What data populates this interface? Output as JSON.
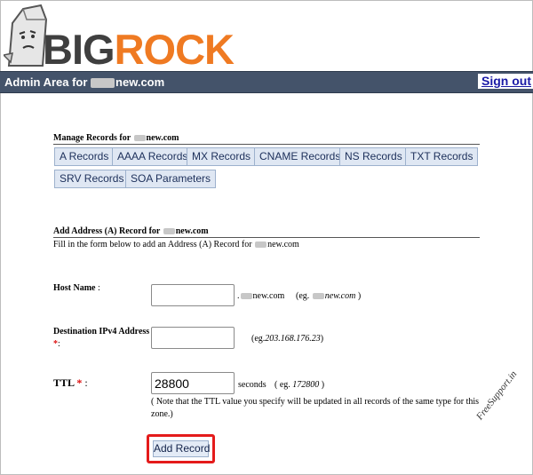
{
  "logo": {
    "big": "BIG",
    "rock": "ROCK"
  },
  "admin_bar": {
    "title_prefix": "Admin Area for ",
    "title_domain": "new.com",
    "sign_out": "Sign out"
  },
  "manage": {
    "heading_prefix": "Manage Records for ",
    "heading_domain": "new.com",
    "buttons": [
      "A Records",
      "AAAA Records",
      "MX Records",
      "CNAME Records",
      "NS Records",
      "TXT Records",
      "SRV Records",
      "SOA Parameters"
    ]
  },
  "add_record": {
    "heading_prefix": "Add Address (A) Record for ",
    "heading_domain": "new.com",
    "description_prefix": "Fill in the form below to add an Address (A) Record for ",
    "description_domain": "new.com"
  },
  "form": {
    "host_name": {
      "label": "Host Name",
      "colon": " :",
      "value": "",
      "suffix_domain": "new.com",
      "example_prefix": "(eg. ",
      "example_domain": "new.com",
      "example_close": ")"
    },
    "destination": {
      "label": "Destination IPv4 Address",
      "required_mark": "*",
      "colon": ":",
      "value": "",
      "example_prefix": "(eg.",
      "example_ip": "203.168.176.23",
      "example_close": ")"
    },
    "ttl": {
      "label": "TTL",
      "required_mark": "*",
      "colon": " :",
      "value": "28800",
      "unit": "seconds",
      "example_prefix": "( eg. ",
      "example_value": "172800",
      "example_close": " )",
      "note": "( Note that the TTL value you specify will be updated in all records of the same type for this zone.)"
    },
    "submit_label": "Add Record"
  },
  "watermark": "FreeSupport.in",
  "colors": {
    "admin_bar": "#44536a",
    "logo_orange": "#ef7a22",
    "logo_gray": "#3f3f3f",
    "highlight": "#e41b1b",
    "button_bg": "#dfe7f3"
  }
}
